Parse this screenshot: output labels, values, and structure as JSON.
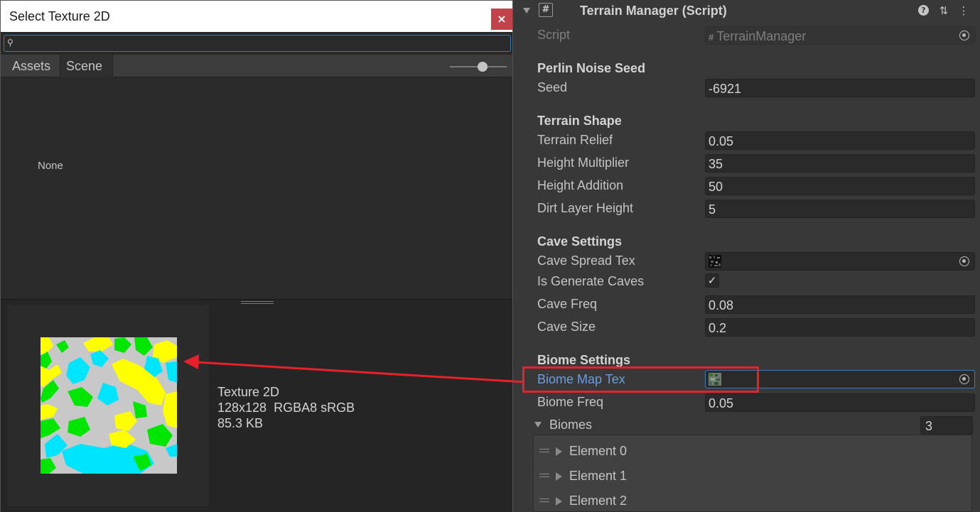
{
  "picker_window": {
    "title": "Select Texture 2D",
    "close_glyph": "×",
    "search": {
      "value": "",
      "icon": "search-icon"
    },
    "tabs": [
      {
        "label": "Assets"
      },
      {
        "label": "Scene"
      }
    ],
    "none_item": "None",
    "preview": {
      "type": "Texture 2D",
      "format": "128x128  RGBA8 sRGB",
      "size": "85.3 KB",
      "colors": [
        "#c8c8c8",
        "#ffff00",
        "#00e600",
        "#00e5ff"
      ]
    }
  },
  "inspector": {
    "component_title": "Terrain Manager (Script)",
    "header_icons": [
      "help-icon",
      "preset-icon",
      "more-icon"
    ],
    "script": {
      "label": "Script",
      "value": "TerrainManager"
    },
    "sections": {
      "perlin": "Perlin Noise Seed",
      "terrain": "Terrain Shape",
      "cave": "Cave Settings",
      "biome": "Biome Settings"
    },
    "fields": {
      "seed": {
        "label": "Seed",
        "value": "-6921"
      },
      "terrain_relief": {
        "label": "Terrain Relief",
        "value": "0.05"
      },
      "height_multiplier": {
        "label": "Height Multiplier",
        "value": "35"
      },
      "height_addition": {
        "label": "Height Addition",
        "value": "50"
      },
      "dirt_layer_height": {
        "label": "Dirt Layer Height",
        "value": "5"
      },
      "cave_spread_tex": {
        "label": "Cave Spread Tex"
      },
      "is_generate_caves": {
        "label": "Is Generate Caves",
        "checked": true
      },
      "cave_freq": {
        "label": "Cave Freq",
        "value": "0.08"
      },
      "cave_size": {
        "label": "Cave Size",
        "value": "0.2"
      },
      "biome_map_tex": {
        "label": "Biome Map Tex"
      },
      "biome_freq": {
        "label": "Biome Freq",
        "value": "0.05"
      }
    },
    "biomes": {
      "label": "Biomes",
      "count": "3",
      "elements": [
        "Element 0",
        "Element 1",
        "Element 2"
      ]
    }
  },
  "annotation": {
    "color": "#e8202a"
  }
}
